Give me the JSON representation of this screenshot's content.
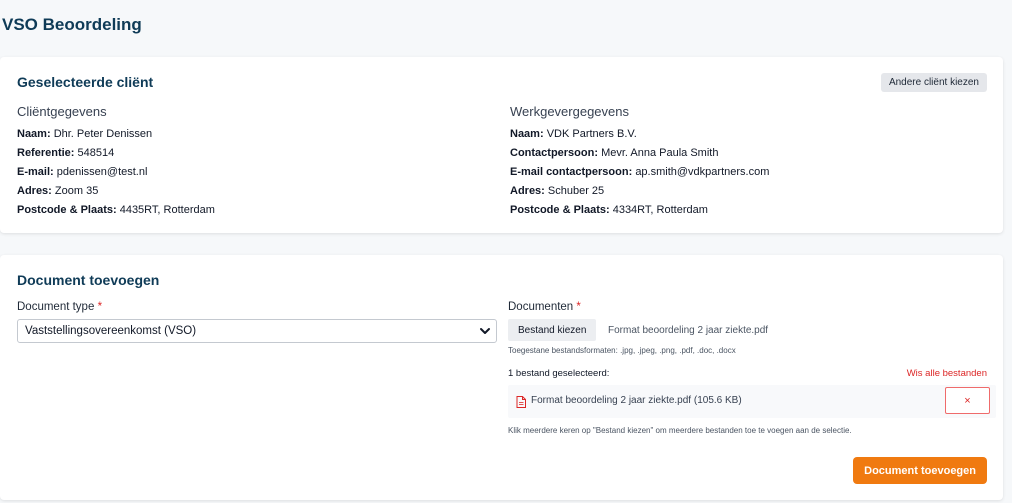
{
  "page": {
    "title": "VSO Beoordeling"
  },
  "client_card": {
    "title": "Geselecteerde cliënt",
    "change_button": "Andere cliënt kiezen",
    "client": {
      "heading": "Cliëntgegevens",
      "rows": [
        {
          "label": "Naam:",
          "value": "Dhr. Peter Denissen"
        },
        {
          "label": "Referentie:",
          "value": "548514"
        },
        {
          "label": "E-mail:",
          "value": "pdenissen@test.nl"
        },
        {
          "label": "Adres:",
          "value": "Zoom 35"
        },
        {
          "label": "Postcode & Plaats:",
          "value": "4435RT, Rotterdam"
        }
      ]
    },
    "employer": {
      "heading": "Werkgevergegevens",
      "rows": [
        {
          "label": "Naam:",
          "value": "VDK Partners B.V."
        },
        {
          "label": "Contactpersoon:",
          "value": "Mevr. Anna Paula Smith"
        },
        {
          "label": "E-mail contactpersoon:",
          "value": "ap.smith@vdkpartners.com"
        },
        {
          "label": "Adres:",
          "value": "Schuber 25"
        },
        {
          "label": "Postcode & Plaats:",
          "value": "4334RT, Rotterdam"
        }
      ]
    }
  },
  "document_card": {
    "title": "Document toevoegen",
    "doc_type": {
      "label": "Document type",
      "required_mark": "*",
      "selected": "Vaststellingsovereenkomst (VSO)"
    },
    "documents": {
      "label": "Documenten",
      "required_mark": "*",
      "choose_button": "Bestand kiezen",
      "chosen_file": "Format beoordeling 2 jaar ziekte.pdf",
      "allowed_formats": "Toegestane bestandsformaten: .jpg, .jpeg, .png, .pdf, .doc, .docx",
      "selected_count": "1 bestand geselecteerd:",
      "clear_all": "Wis alle bestanden",
      "files": [
        {
          "name": "Format beoordeling 2 jaar ziekte.pdf (105.6 KB)",
          "remove": "×"
        }
      ],
      "multi_hint": "Klik meerdere keren op \"Bestand kiezen\" om meerdere bestanden toe te voegen aan de selectie."
    },
    "submit_button": "Document toevoegen"
  },
  "colors": {
    "title": "#0f3b57",
    "accent": "#f07a10",
    "danger": "#dc2626"
  }
}
